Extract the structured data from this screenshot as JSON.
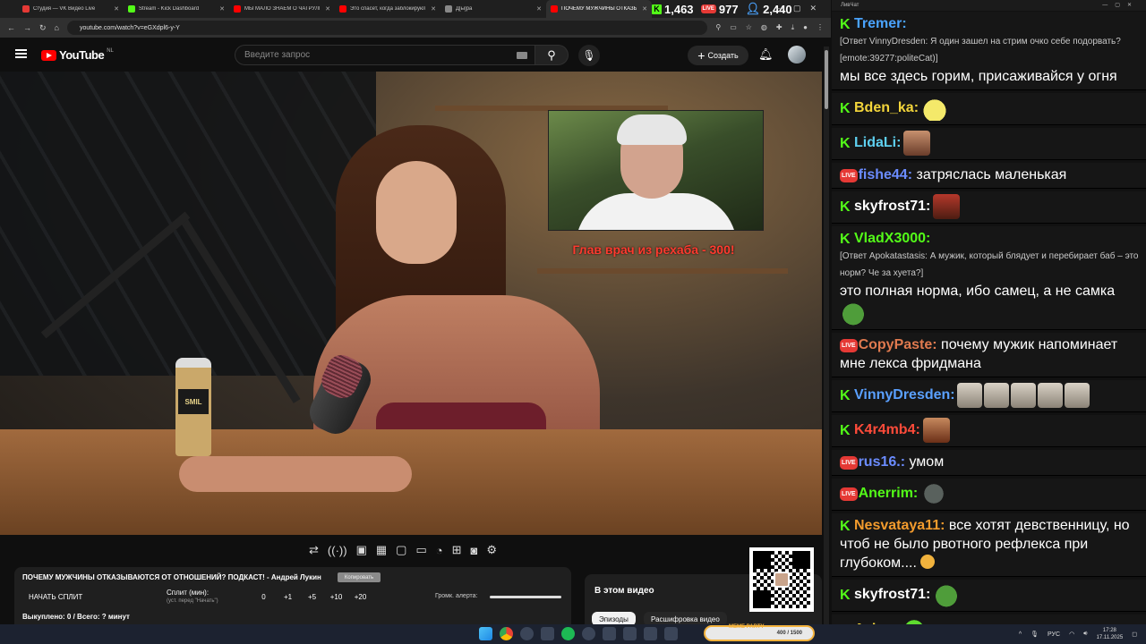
{
  "browser": {
    "tabs": [
      {
        "title": "Студия — VK Видео Live",
        "color": "#e53935"
      },
      {
        "title": "Stream - Kick Dashboard",
        "color": "#53fc18"
      },
      {
        "title": "МЫ МАЛО ЗНАЕМ О ЧАТРУЛЕТ",
        "color": "#ff0000"
      },
      {
        "title": "Это спасет, когда заблокируют",
        "color": "#ff0000"
      },
      {
        "title": "Д[ы]ра",
        "color": "#888888"
      },
      {
        "title": "ПОЧЕМУ МУЖЧИНЫ ОТКАЗЫВ",
        "color": "#ff0000"
      }
    ],
    "url": "youtube.com/watch?v=eGXdpl6-y-Y"
  },
  "stats": {
    "kick": "1,463",
    "vk": "977",
    "viewers": "2,440"
  },
  "youtube": {
    "logo_text": "YouTube",
    "region": "NL",
    "search_placeholder": "Введите запрос",
    "create_label": "Создать"
  },
  "video": {
    "caption": "Глав врач из рехаба - 300!",
    "bottle_label": "SMIL"
  },
  "info": {
    "title": "ПОЧЕМУ МУЖЧИНЫ ОТКАЗЫВАЮТСЯ ОТ ОТНОШЕНИЙ? ПОДКАСТ! - Андрей Лукин",
    "tag": "Копировать",
    "split_button": "НАЧАТЬ СПЛИТ",
    "split_label": "Сплит (мин):",
    "split_sub": "(уст. перед \"Начать\")",
    "split_values": [
      "0",
      "+1",
      "+5",
      "+10",
      "+20"
    ],
    "volume_label": "Громк. алерта:",
    "bought": "Выкуплено: 0 / Всего: ? минут"
  },
  "in_video": {
    "heading": "В этом видео",
    "chips": [
      "Эпизоды",
      "Расшифровка видео"
    ]
  },
  "chat": {
    "window_title": "ЛивЧат",
    "messages": [
      {
        "platform": "kick",
        "user": "Tremer:",
        "cls": "c-tremer",
        "reply": "[Ответ VinnyDresden: Я один зашел на стрим очко себе подорвать?",
        "reply2": "[emote:39277:politeCat)]",
        "text": "мы все здесь горим, присаживайся у огня",
        "emote": ""
      },
      {
        "platform": "kick",
        "user": "Bden_ka:",
        "cls": "c-bden",
        "text": "",
        "emote": "e-yellow"
      },
      {
        "platform": "kick",
        "user": "LidaLi:",
        "cls": "c-lida",
        "text": "",
        "emote": "e-face"
      },
      {
        "platform": "vk",
        "user": "fishe44:",
        "cls": "c-fishe",
        "text": "затряслась маленькая",
        "emote": ""
      },
      {
        "platform": "kick",
        "user": "skyfrost71:",
        "cls": "c-sky",
        "text": "",
        "emote": "e-red"
      },
      {
        "platform": "kick",
        "user": "VladX3000:",
        "cls": "c-vlad",
        "reply": "[Ответ Apokatastasis: А мужик, который блядует и перебирает баб – это норм? Че за хуета?]",
        "text": "это полная норма, ибо самец, а не самка",
        "emote": "e-pepe",
        "emote_newline": true
      },
      {
        "platform": "vk",
        "user": "CopyPaste:",
        "cls": "c-copy",
        "text": "почему мужик напоминает мне лекса фридмана",
        "emote": ""
      },
      {
        "platform": "kick",
        "user": "VinnyDresden:",
        "cls": "c-vinny",
        "text": "",
        "emote": "cats"
      },
      {
        "platform": "kick",
        "user": "K4r4mb4:",
        "cls": "c-k4r",
        "text": "",
        "emote": "e-doom"
      },
      {
        "platform": "vk",
        "user": "rus16.:",
        "cls": "c-rus",
        "text": "умом",
        "emote": ""
      },
      {
        "platform": "vk",
        "user": "Anerrim:",
        "cls": "c-aner",
        "text": "",
        "emote": "e-seal"
      },
      {
        "platform": "kick",
        "user": "Nesvataya11:",
        "cls": "c-nes",
        "text": "все хотят девственницу, но чтоб не было рвотного рефлекса при глубоком....",
        "emote": "smile"
      },
      {
        "platform": "kick",
        "user": "skyfrost71:",
        "cls": "c-sky",
        "text": "",
        "emote": "e-pepe"
      },
      {
        "platform": "kick",
        "user": "Aviqq:",
        "cls": "c-aviq",
        "text": "",
        "emote": "e-green"
      }
    ]
  },
  "taskbar": {
    "meme_label": "MEME PARTY",
    "meme_progress": "400 / 1500",
    "lang": "РУС",
    "time": "17:28",
    "date": "17.11.2025"
  }
}
